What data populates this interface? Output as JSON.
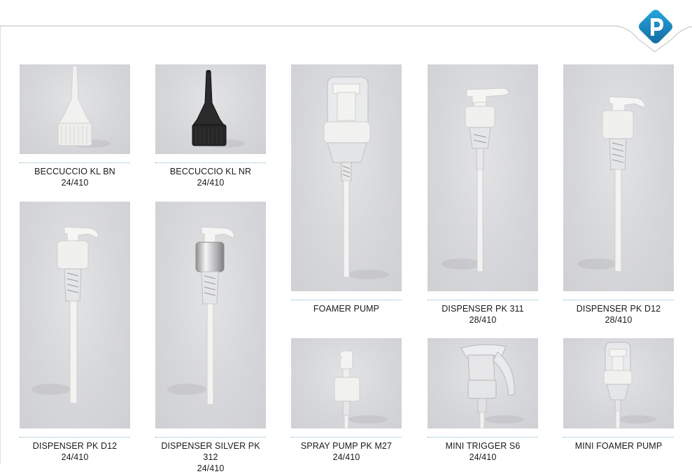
{
  "products": [
    {
      "name": "BECCUCCIO KL BN",
      "size": "24/410",
      "icon": "white-spout-cap"
    },
    {
      "name": "BECCUCCIO KL NR",
      "size": "24/410",
      "icon": "black-spout-cap"
    },
    {
      "name": "FOAMER PUMP",
      "size": "",
      "icon": "foamer-pump"
    },
    {
      "name": "DISPENSER PK 311",
      "size": "28/410",
      "icon": "lotion-dispenser"
    },
    {
      "name": "DISPENSER PK D12",
      "size": "28/410",
      "icon": "lotion-dispenser"
    },
    {
      "name": "DISPENSER PK D12",
      "size": "24/410",
      "icon": "lotion-dispenser"
    },
    {
      "name": "DISPENSER SILVER PK 312",
      "size": "24/410",
      "icon": "silver-lotion-dispenser"
    },
    {
      "name": "SPRAY PUMP PK M27",
      "size": "24/410",
      "icon": "spray-pump"
    },
    {
      "name": "MINI TRIGGER S6",
      "size": "24/410",
      "icon": "mini-trigger"
    },
    {
      "name": "MINI FOAMER PUMP",
      "size": "",
      "icon": "mini-foamer-pump"
    }
  ],
  "colors": {
    "accent": "#1a8fc4",
    "photo_bg": "#d8d9dc",
    "dots": "#7fb7c9"
  },
  "logo_icon": "p-brand-logo"
}
